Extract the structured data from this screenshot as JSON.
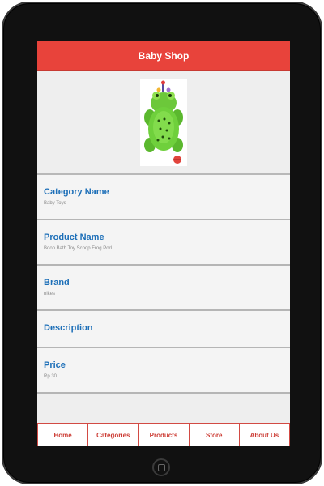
{
  "header": {
    "title": "Baby Shop"
  },
  "product": {
    "image_icon": "frog-bath-toy-image",
    "category": {
      "label": "Category Name",
      "value": "Baby Toys"
    },
    "name": {
      "label": "Product Name",
      "value": "Boon Bath Toy Scoop Frog Pod"
    },
    "brand": {
      "label": "Brand",
      "value": "nikes"
    },
    "description": {
      "label": "Description",
      "value": ""
    },
    "price": {
      "label": "Price",
      "value": "Rp 30"
    }
  },
  "footer": {
    "tabs": [
      {
        "label": "Home"
      },
      {
        "label": "Categories"
      },
      {
        "label": "Products"
      },
      {
        "label": "Store"
      },
      {
        "label": "About Us"
      }
    ]
  },
  "colors": {
    "accent": "#e8433b",
    "label_blue": "#1d6fb8"
  }
}
